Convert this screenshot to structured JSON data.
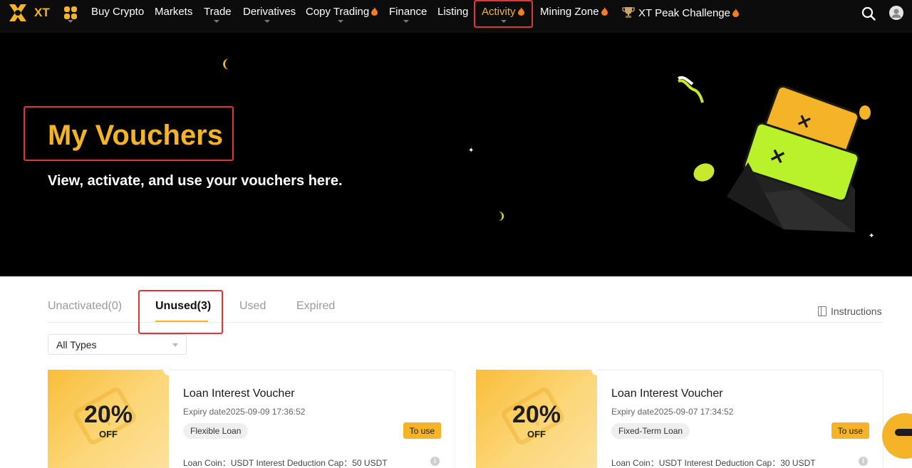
{
  "nav": {
    "logo_text": "XT",
    "items": [
      {
        "label": "Buy Crypto"
      },
      {
        "label": "Markets"
      },
      {
        "label": "Trade"
      },
      {
        "label": "Derivatives"
      },
      {
        "label": "Copy Trading"
      },
      {
        "label": "Finance"
      },
      {
        "label": "Listing"
      },
      {
        "label": "Activity"
      },
      {
        "label": "Mining Zone"
      },
      {
        "label": "XT Peak Challenge"
      }
    ],
    "active_item": "Activity",
    "icons": [
      "apps-grid-icon",
      "search-icon",
      "user-icon"
    ]
  },
  "hero": {
    "title": "My Vouchers",
    "subtitle": "View, activate, and use your vouchers here."
  },
  "tabs": [
    {
      "label": "Unactivated(0)"
    },
    {
      "label": "Unused(3)"
    },
    {
      "label": "Used"
    },
    {
      "label": "Expired"
    }
  ],
  "active_tab": "Unused(3)",
  "instructions_label": "Instructions",
  "filter": {
    "selected": "All Types"
  },
  "vouchers": [
    {
      "discount": "20%",
      "off_label": "OFF",
      "name": "Loan Interest Voucher",
      "expiry": "Expiry date2025-09-09 17:36:52",
      "tag": "Flexible Loan",
      "button": "To use",
      "detail": "Loan Coin：USDT  Interest Deduction Cap：50  USDT"
    },
    {
      "discount": "20%",
      "off_label": "OFF",
      "name": "Loan Interest Voucher",
      "expiry": "Expiry date2025-09-07 17:34:52",
      "tag": "Fixed-Term Loan",
      "button": "To use",
      "detail": "Loan Coin：USDT  Interest Deduction Cap：30  USDT"
    }
  ],
  "colors": {
    "accent": "#f5b427",
    "highlight_box": "#e2343c",
    "nav_bg": "#0c0c0c",
    "hero_bg": "#000000"
  }
}
